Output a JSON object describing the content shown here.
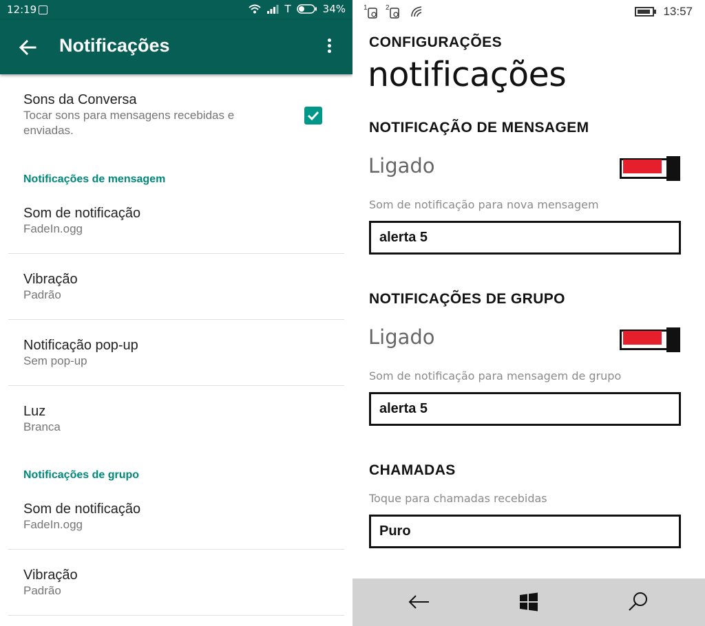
{
  "android": {
    "status": {
      "time": "12:19",
      "carrier_letter": "T",
      "battery": "34%"
    },
    "toolbar": {
      "title": "Notificações"
    },
    "conversation_tones": {
      "title": "Sons da Conversa",
      "summary_line1": "Tocar sons para mensagens recebidas e",
      "summary_line2": "enviadas.",
      "checked": true
    },
    "message_section": {
      "header": "Notificações de mensagem",
      "items": [
        {
          "title": "Som de notificação",
          "value": "FadeIn.ogg"
        },
        {
          "title": "Vibração",
          "value": "Padrão"
        },
        {
          "title": "Notificação pop-up",
          "value": "Sem pop-up"
        },
        {
          "title": "Luz",
          "value": "Branca"
        }
      ]
    },
    "group_section": {
      "header": "Notificações de grupo",
      "items": [
        {
          "title": "Som de notificação",
          "value": "FadeIn.ogg"
        },
        {
          "title": "Vibração",
          "value": "Padrão"
        }
      ]
    },
    "colors": {
      "primary": "#075e54",
      "accent": "#00897b",
      "checkbox": "#009688"
    }
  },
  "wp": {
    "status": {
      "time": "13:57",
      "sim1_label": "1",
      "sim2_label": "2"
    },
    "app_title": "CONFIGURAÇÕES",
    "page_title": "notificações",
    "message_section": {
      "header": "NOTIFICAÇÃO DE MENSAGEM",
      "toggle_label": "Ligado",
      "toggle_on": true,
      "sound_label": "Som de notificação para nova mensagem",
      "sound_value": "alerta 5"
    },
    "group_section": {
      "header": "NOTIFICAÇÕES DE GRUPO",
      "toggle_label": "Ligado",
      "toggle_on": true,
      "sound_label": "Som de notificação para mensagem de grupo",
      "sound_value": "alerta 5"
    },
    "calls_section": {
      "header": "CHAMADAS",
      "ringtone_label": "Toque para chamadas recebidas",
      "ringtone_value": "Puro"
    },
    "appbar": {
      "icons": [
        "back-arrow-icon",
        "windows-logo-icon",
        "search-icon"
      ]
    },
    "colors": {
      "toggle_fill": "#e51f2b",
      "appbar_bg": "#d2d2d2"
    }
  }
}
